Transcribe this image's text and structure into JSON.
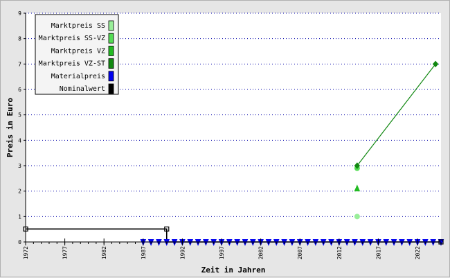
{
  "chart_data": {
    "type": "line",
    "xlabel": "Zeit in Jahren",
    "ylabel": "Preis in Euro",
    "xlim": [
      1972,
      2025
    ],
    "ylim": [
      0,
      9
    ],
    "x_ticks": [
      "1972",
      "1977",
      "1982",
      "1987",
      "1992",
      "1997",
      "2002",
      "2007",
      "2012",
      "2017",
      "2022"
    ],
    "y_ticks": [
      "0",
      "1",
      "2",
      "3",
      "4",
      "5",
      "6",
      "7",
      "8",
      "9"
    ],
    "grid": "horizontal dotted",
    "legend_position": "top-left",
    "series": [
      {
        "name": "Marktpreis SS",
        "color": "#99ee99",
        "marker": "circle",
        "points": [
          [
            2014.3,
            1.0
          ]
        ]
      },
      {
        "name": "Marktpreis SS-VZ",
        "color": "#55dd55",
        "marker": "circle",
        "points": [
          [
            2014.3,
            2.9
          ]
        ]
      },
      {
        "name": "Marktpreis VZ",
        "color": "#22bb22",
        "marker": "triangle-up",
        "points": [
          [
            2014.3,
            2.1
          ]
        ]
      },
      {
        "name": "Marktpreis VZ-ST",
        "color": "#118811",
        "marker": "diamond",
        "line": true,
        "points": [
          [
            2014.3,
            3.0
          ],
          [
            2024.3,
            7.0
          ]
        ]
      },
      {
        "name": "Materialpreis",
        "color": "#0000ee",
        "marker": "triangle-down",
        "line": true,
        "points": [
          [
            1987.0,
            0
          ],
          [
            1988.0,
            0
          ],
          [
            1989.0,
            0
          ],
          [
            1990.0,
            0
          ],
          [
            1991.0,
            0
          ],
          [
            1992.0,
            0
          ],
          [
            1993.0,
            0
          ],
          [
            1994.0,
            0
          ],
          [
            1995.0,
            0
          ],
          [
            1996.0,
            0
          ],
          [
            1997.0,
            0
          ],
          [
            1998.0,
            0
          ],
          [
            1999.0,
            0
          ],
          [
            2000.0,
            0
          ],
          [
            2001.0,
            0
          ],
          [
            2002.0,
            0
          ],
          [
            2003.0,
            0
          ],
          [
            2004.0,
            0
          ],
          [
            2005.0,
            0
          ],
          [
            2006.0,
            0
          ],
          [
            2007.0,
            0
          ],
          [
            2008.0,
            0
          ],
          [
            2009.0,
            0
          ],
          [
            2010.0,
            0
          ],
          [
            2011.0,
            0
          ],
          [
            2012.0,
            0
          ],
          [
            2013.0,
            0
          ],
          [
            2014.0,
            0
          ],
          [
            2015.0,
            0
          ],
          [
            2016.0,
            0
          ],
          [
            2017.0,
            0
          ],
          [
            2018.0,
            0
          ],
          [
            2019.0,
            0
          ],
          [
            2020.0,
            0
          ],
          [
            2021.0,
            0
          ],
          [
            2022.0,
            0
          ],
          [
            2023.0,
            0
          ],
          [
            2024.0,
            0
          ],
          [
            2025.0,
            0
          ]
        ]
      },
      {
        "name": "Nominalwert",
        "color": "#000000",
        "marker": "square",
        "line": true,
        "step": true,
        "points": [
          [
            1972.0,
            0.51
          ],
          [
            1990.0,
            0.51
          ],
          [
            1990.0,
            0
          ],
          [
            2025.0,
            0
          ]
        ]
      }
    ]
  }
}
